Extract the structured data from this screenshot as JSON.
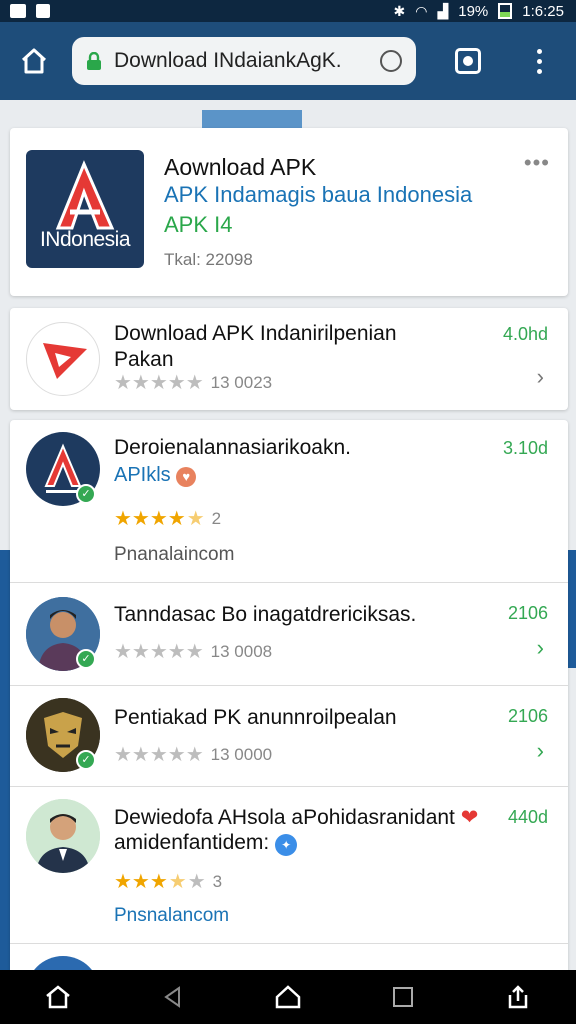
{
  "statusbar": {
    "battery": "19%",
    "time": "1:6:25"
  },
  "browser": {
    "url": "Download INdaiankAgK.",
    "icons": [
      "home-icon",
      "lock-icon",
      "reload-icon",
      "tabs-icon",
      "more-vert-icon"
    ]
  },
  "hero": {
    "logo_text": "INdonesia",
    "title": "Aownload APK",
    "subtitle": "APK Indamagis baua Indonesia",
    "subtitle2": "APK I4",
    "meta": "Tkal: 22098",
    "more": "•••"
  },
  "row1": {
    "title_line1": "Download APK Indanirilpenian",
    "title_line2": "Pakan",
    "price": "4.0hd",
    "rating_count": "13 0023",
    "stars": {
      "filled": 0,
      "total": 5
    }
  },
  "items": [
    {
      "title": "Deroienalannasiarikoakn.",
      "sub": "APIkls",
      "price": "3.10d",
      "stars": {
        "filled": 4.5,
        "total": 5
      },
      "rating_count": "2",
      "developer": "Pnanalaincom"
    },
    {
      "title": "Tanndasac Bo inagatdrericiksas.",
      "price": "2106",
      "stars": {
        "filled": 0,
        "total": 5
      },
      "rating_count": "13 0008"
    },
    {
      "title": "Pentiakad PK anunnroilpealan",
      "price": "2106",
      "stars": {
        "filled": 0,
        "total": 5
      },
      "rating_count": "13 0000"
    },
    {
      "title": "Dewiedofa AHsola aPohidasranidant",
      "title_line2": "amidenfantidem:",
      "price": "440d",
      "stars": {
        "filled": 3.5,
        "total": 5
      },
      "rating_count": "3",
      "developer": "Pnsnalancom"
    }
  ],
  "colors": {
    "appbar": "#1e4d7a",
    "link_blue": "#1a73b5",
    "green": "#34a853",
    "star_gold": "#f0a500"
  }
}
